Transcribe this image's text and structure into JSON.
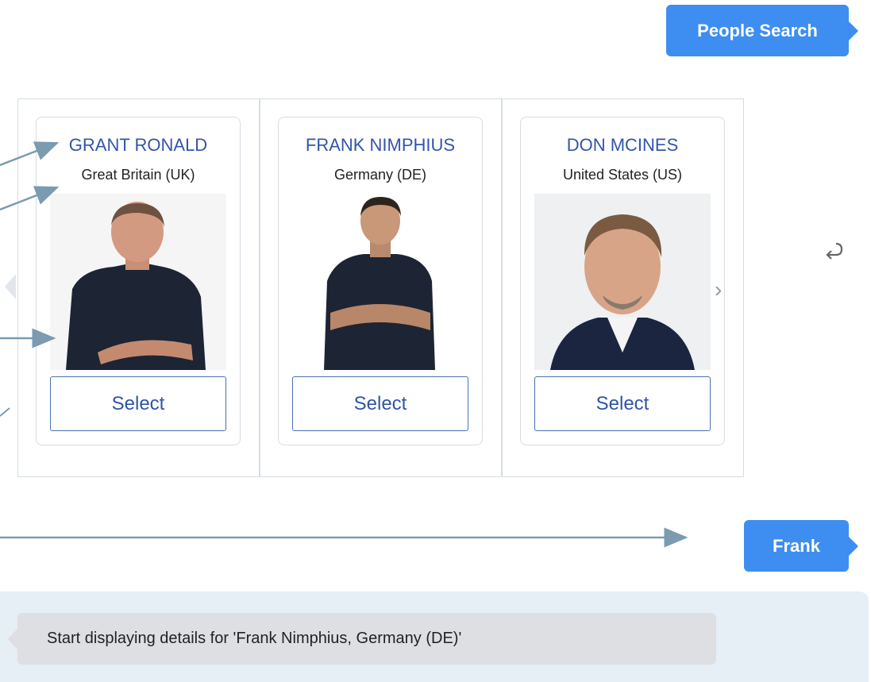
{
  "user_messages": {
    "search": "People Search",
    "reply": "Frank"
  },
  "cards": [
    {
      "name": "GRANT RONALD",
      "country": "Great Britain (UK)",
      "select_label": "Select"
    },
    {
      "name": "FRANK NIMPHIUS",
      "country": "Germany (DE)",
      "select_label": "Select"
    },
    {
      "name": "DON MCINES",
      "country": "United States (US)",
      "select_label": "Select"
    }
  ],
  "bot_message": "Start displaying details for 'Frank Nimphius, Germany (DE)'",
  "icons": {
    "prev": "chevron-left-icon",
    "next": "chevron-right-icon",
    "reload": "reload-icon"
  },
  "colors": {
    "user_bubble": "#3d8ef0",
    "card_name": "#3355aa",
    "select_border": "#4a72b8",
    "bot_panel": "#e6eef6",
    "bot_bubble": "#dedfe2",
    "annotation_arrow": "#7a9bb0"
  }
}
